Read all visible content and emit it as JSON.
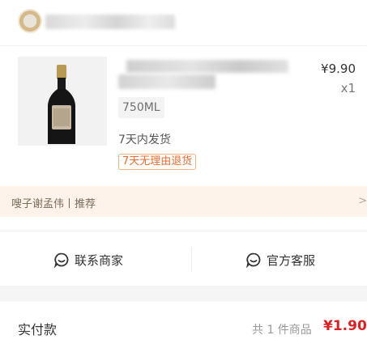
{
  "store": {
    "avatar_icon": "store-avatar-icon",
    "name_blurred": true
  },
  "product": {
    "title_blurred": true,
    "price": "¥9.90",
    "quantity": "x1",
    "spec": "750ML",
    "shipping": "7天内发货",
    "return_policy": "7天无理由退货",
    "image_icon": "wine-bottle-icon"
  },
  "recommend": {
    "text": "嗖子谢孟伟丨推荐",
    "arrow": ">"
  },
  "contact": {
    "merchant_label": "联系商家",
    "merchant_icon": "chat-bubble-icon",
    "service_label": "官方客服",
    "service_icon": "chat-bubble-icon"
  },
  "payment": {
    "label": "实付款",
    "count": "共 1 件商品",
    "amount": "¥1.90"
  },
  "colors": {
    "accent_red": "#e02020",
    "badge_orange": "#e86a2c",
    "recommend_bg": "#fdf3ea"
  }
}
